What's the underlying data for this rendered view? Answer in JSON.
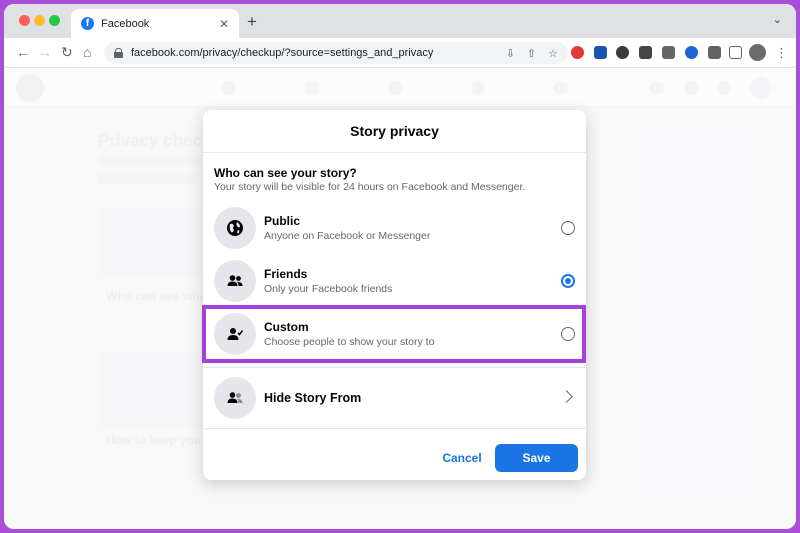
{
  "browser": {
    "tab_title": "Facebook",
    "tab_favicon": "f",
    "url": "facebook.com/privacy/checkup/?source=settings_and_privacy",
    "new_tab_symbol": "+",
    "close_symbol": "✕"
  },
  "background": {
    "title": "Privacy checkup",
    "card1_text": "Who can see what you share",
    "card2_text": "How to keep your account secure"
  },
  "modal": {
    "title": "Story privacy",
    "question": "Who can see your story?",
    "subtitle": "Your story will be visible for 24 hours on Facebook and Messenger.",
    "options": [
      {
        "title": "Public",
        "description": "Anyone on Facebook or Messenger",
        "icon": "globe-icon",
        "selected": false
      },
      {
        "title": "Friends",
        "description": "Only your Facebook friends",
        "icon": "friends-icon",
        "selected": true
      },
      {
        "title": "Custom",
        "description": "Choose people to show your story to",
        "icon": "custom-person-icon",
        "selected": false
      }
    ],
    "hide_story": {
      "title": "Hide Story From",
      "icon": "hide-people-icon"
    },
    "cancel_label": "Cancel",
    "save_label": "Save"
  },
  "colors": {
    "accent": "#1b74e4",
    "highlight": "#a640dc"
  }
}
